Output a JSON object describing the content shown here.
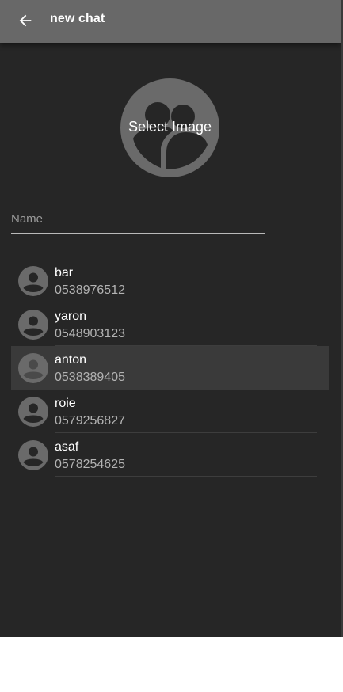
{
  "appbar": {
    "title": "new chat",
    "back_icon": "arrow-back-icon"
  },
  "image_picker": {
    "label": "Select Image",
    "icon": "group-avatar-icon"
  },
  "name_input": {
    "placeholder": "Name",
    "value": ""
  },
  "contacts": [
    {
      "name": "bar",
      "phone": "0538976512",
      "selected": false
    },
    {
      "name": "yaron",
      "phone": "0548903123",
      "selected": false
    },
    {
      "name": "anton",
      "phone": "0538389405",
      "selected": true
    },
    {
      "name": "roie",
      "phone": "0579256827",
      "selected": false
    },
    {
      "name": "asaf",
      "phone": "0578254625",
      "selected": false
    }
  ],
  "colors": {
    "background": "#262626",
    "appbar": "#686868",
    "selected_row": "#3a3a3a",
    "avatar": "#6a6a6a"
  }
}
